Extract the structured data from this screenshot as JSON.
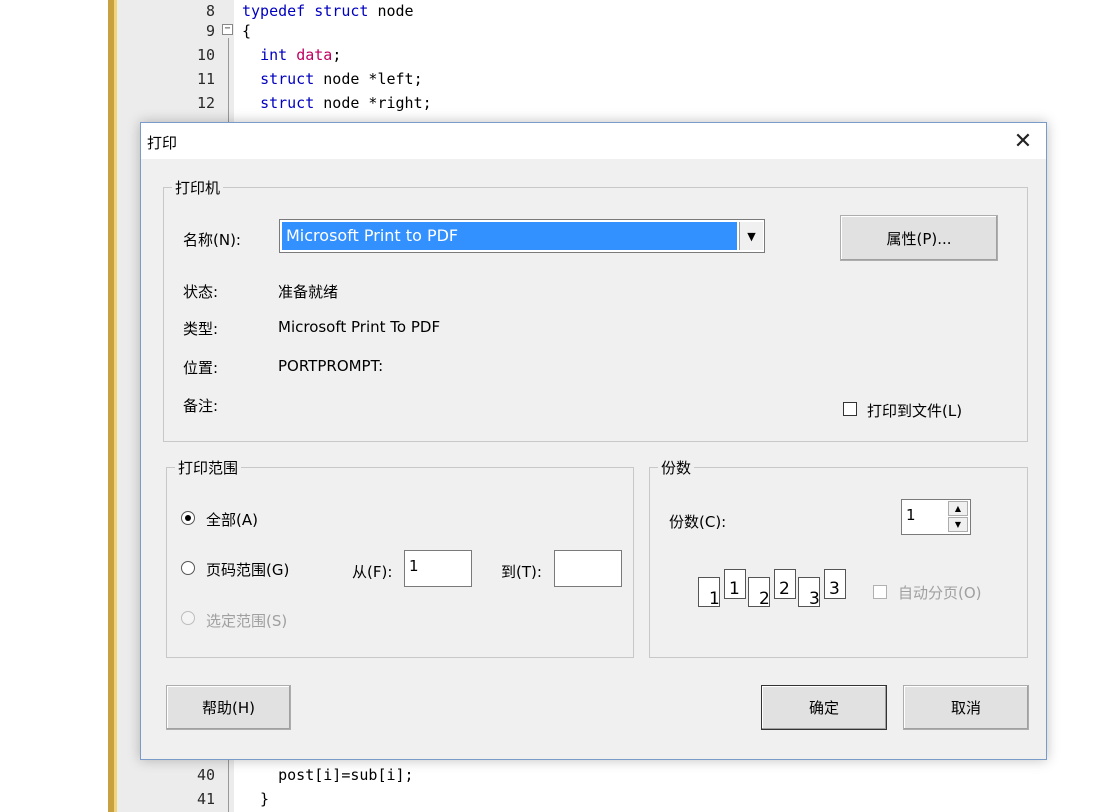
{
  "editor": {
    "lines": [
      {
        "num": "8",
        "parts": [
          {
            "t": "typedef",
            "c": "kw"
          },
          {
            "t": " "
          },
          {
            "t": "struct",
            "c": "kw"
          },
          {
            "t": " node"
          }
        ]
      },
      {
        "num": "9",
        "parts": [
          {
            "t": "{"
          }
        ]
      },
      {
        "num": "10",
        "parts": [
          {
            "t": "  "
          },
          {
            "t": "int",
            "c": "tp"
          },
          {
            "t": " "
          },
          {
            "t": "data",
            "c": "id"
          },
          {
            "t": ";"
          }
        ]
      },
      {
        "num": "11",
        "parts": [
          {
            "t": "  "
          },
          {
            "t": "struct",
            "c": "kw"
          },
          {
            "t": " node *left;"
          }
        ]
      },
      {
        "num": "12",
        "parts": [
          {
            "t": "  "
          },
          {
            "t": "struct",
            "c": "kw"
          },
          {
            "t": " node *right;"
          }
        ]
      },
      {
        "num": "40",
        "parts": [
          {
            "t": "    post[i]=sub[i];"
          }
        ]
      },
      {
        "num": "41",
        "parts": [
          {
            "t": "  }"
          }
        ]
      }
    ]
  },
  "dialog": {
    "title": "打印",
    "close_icon": "close-icon",
    "printer_group": {
      "label": "打印机",
      "name_label": "名称(N):",
      "name_value": "Microsoft Print to PDF",
      "properties_button": "属性(P)...",
      "status_label": "状态:",
      "status_value": "准备就绪",
      "type_label": "类型:",
      "type_value": "Microsoft Print To PDF",
      "location_label": "位置:",
      "location_value": "PORTPROMPT:",
      "comment_label": "备注:",
      "print_to_file_label": "打印到文件(L)",
      "print_to_file_checked": false
    },
    "range_group": {
      "label": "打印范围",
      "all_label": "全部(A)",
      "all_selected": true,
      "pages_label": "页码范围(G)",
      "from_label": "从(F):",
      "from_value": "1",
      "to_label": "到(T):",
      "to_value": "",
      "selection_label": "选定范围(S)"
    },
    "copies_group": {
      "label": "份数",
      "copies_label": "份数(C):",
      "copies_value": "1",
      "collate_label": "自动分页(O)",
      "collate_checked": false,
      "collate_pages": [
        "1",
        "1",
        "2",
        "2",
        "3",
        "3"
      ]
    },
    "buttons": {
      "help": "帮助(H)",
      "ok": "确定",
      "cancel": "取消"
    }
  }
}
